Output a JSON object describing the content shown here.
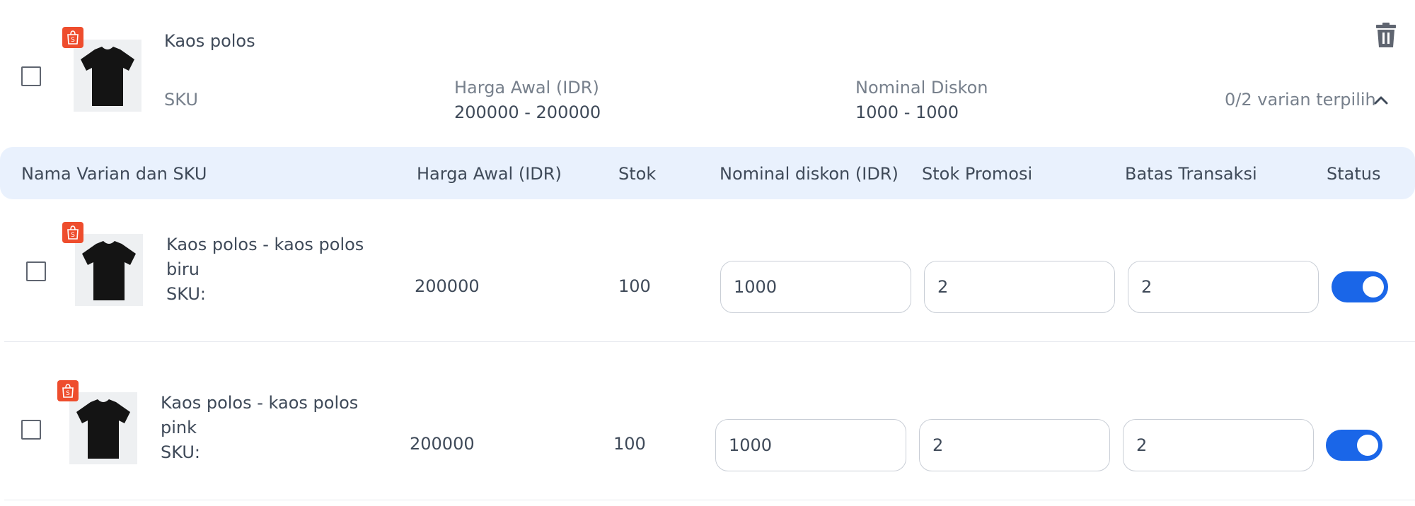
{
  "product": {
    "name": "Kaos polos",
    "sku_label": "SKU",
    "price_label": "Harga Awal (IDR)",
    "price_range": "200000 - 200000",
    "discount_label": "Nominal Diskon",
    "discount_range": "1000 - 1000",
    "variant_selection": "0/2 varian terpilih",
    "checked": false
  },
  "table": {
    "headers": {
      "name_sku": "Nama Varian dan SKU",
      "price": "Harga Awal (IDR)",
      "stock": "Stok",
      "discount": "Nominal diskon (IDR)",
      "promo_stock": "Stok Promosi",
      "trx_limit": "Batas Transaksi",
      "status": "Status"
    },
    "rows": [
      {
        "name_line1": "Kaos polos - kaos polos",
        "name_line2": "biru",
        "sku": "SKU:",
        "price": "200000",
        "stock": "100",
        "discount": "1000",
        "promo_stock": "2",
        "trx_limit": "2",
        "status_on": true,
        "checked": false
      },
      {
        "name_line1": "Kaos polos - kaos polos",
        "name_line2": "pink",
        "sku": "SKU:",
        "price": "200000",
        "stock": "100",
        "discount": "1000",
        "promo_stock": "2",
        "trx_limit": "2",
        "status_on": true,
        "checked": false
      }
    ]
  },
  "icons": {
    "shop_badge": "shopee-bag-icon",
    "delete": "trash-icon",
    "collapse": "chevron-up-icon",
    "product_image": "black-tshirt-image"
  },
  "colors": {
    "header_bg": "#e9f1fd",
    "toggle_on": "#1a66e8",
    "shop_badge": "#ee4d2d"
  }
}
